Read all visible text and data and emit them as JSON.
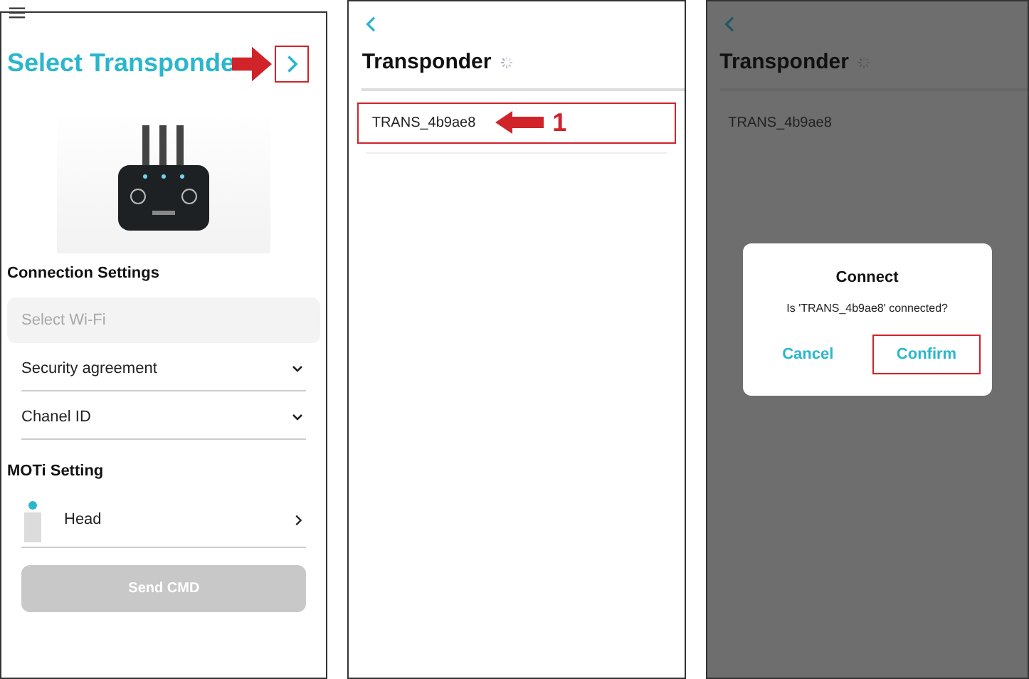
{
  "select_screen": {
    "title": "Select Transponde",
    "connection_heading": "Connection Settings",
    "wifi_field": {
      "placeholder": "Select Wi-Fi"
    },
    "dropdowns": [
      {
        "label": "Security agreement",
        "expanded": false
      },
      {
        "label": "Chanel ID",
        "expanded": false
      }
    ],
    "moti_heading": "MOTi Setting",
    "body_items": [
      {
        "label": "Head"
      }
    ],
    "send_button": {
      "label": "Send CMD",
      "disabled": true
    }
  },
  "list_screen": {
    "title": "Transponder",
    "loading": true,
    "items": [
      {
        "label": "TRANS_4b9ae8",
        "highlighted": true
      }
    ],
    "step_number": "1"
  },
  "dialog_screen": {
    "title": "Transponder",
    "loading": true,
    "items": [
      {
        "label": "TRANS_4b9ae8"
      }
    ],
    "dialog": {
      "title": "Connect",
      "message": "Is 'TRANS_4b9ae8' connected?",
      "buttons": [
        {
          "label": "Cancel",
          "highlighted": false
        },
        {
          "label": "Confirm",
          "highlighted": true
        }
      ]
    }
  }
}
